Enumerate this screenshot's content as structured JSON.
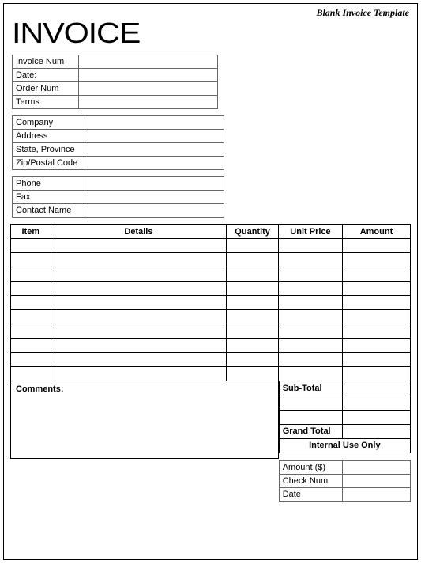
{
  "header_title": "Blank Invoice Template",
  "invoice_word": "INVOICE",
  "invoice_info": {
    "invoice_num_label": "Invoice Num",
    "invoice_num": "",
    "date_label": "Date:",
    "date": "",
    "order_num_label": "Order Num",
    "order_num": "",
    "terms_label": "Terms",
    "terms": ""
  },
  "company_info": {
    "company_label": "Company",
    "company": "",
    "address_label": "Address",
    "address": "",
    "state_label": "State, Province",
    "state": "",
    "zip_label": "Zip/Postal Code",
    "zip": ""
  },
  "contact_info": {
    "phone_label": "Phone",
    "phone": "",
    "fax_label": "Fax",
    "fax": "",
    "contact_label": "Contact Name",
    "contact": ""
  },
  "items": {
    "headers": {
      "item": "Item",
      "details": "Details",
      "quantity": "Quantity",
      "unit_price": "Unit Price",
      "amount": "Amount"
    },
    "rows": [
      {
        "item": "",
        "details": "",
        "quantity": "",
        "unit_price": "",
        "amount": ""
      },
      {
        "item": "",
        "details": "",
        "quantity": "",
        "unit_price": "",
        "amount": ""
      },
      {
        "item": "",
        "details": "",
        "quantity": "",
        "unit_price": "",
        "amount": ""
      },
      {
        "item": "",
        "details": "",
        "quantity": "",
        "unit_price": "",
        "amount": ""
      },
      {
        "item": "",
        "details": "",
        "quantity": "",
        "unit_price": "",
        "amount": ""
      },
      {
        "item": "",
        "details": "",
        "quantity": "",
        "unit_price": "",
        "amount": ""
      },
      {
        "item": "",
        "details": "",
        "quantity": "",
        "unit_price": "",
        "amount": ""
      },
      {
        "item": "",
        "details": "",
        "quantity": "",
        "unit_price": "",
        "amount": ""
      },
      {
        "item": "",
        "details": "",
        "quantity": "",
        "unit_price": "",
        "amount": ""
      },
      {
        "item": "",
        "details": "",
        "quantity": "",
        "unit_price": "",
        "amount": ""
      }
    ]
  },
  "comments_label": "Comments:",
  "totals": {
    "subtotal_label": "Sub-Total",
    "subtotal": "",
    "grandtotal_label": "Grand Total",
    "grandtotal": "",
    "internal_label": "Internal Use Only"
  },
  "internal": {
    "amount_label": "Amount ($)",
    "amount": "",
    "check_label": "Check Num",
    "check": "",
    "date_label": "Date",
    "date": ""
  }
}
